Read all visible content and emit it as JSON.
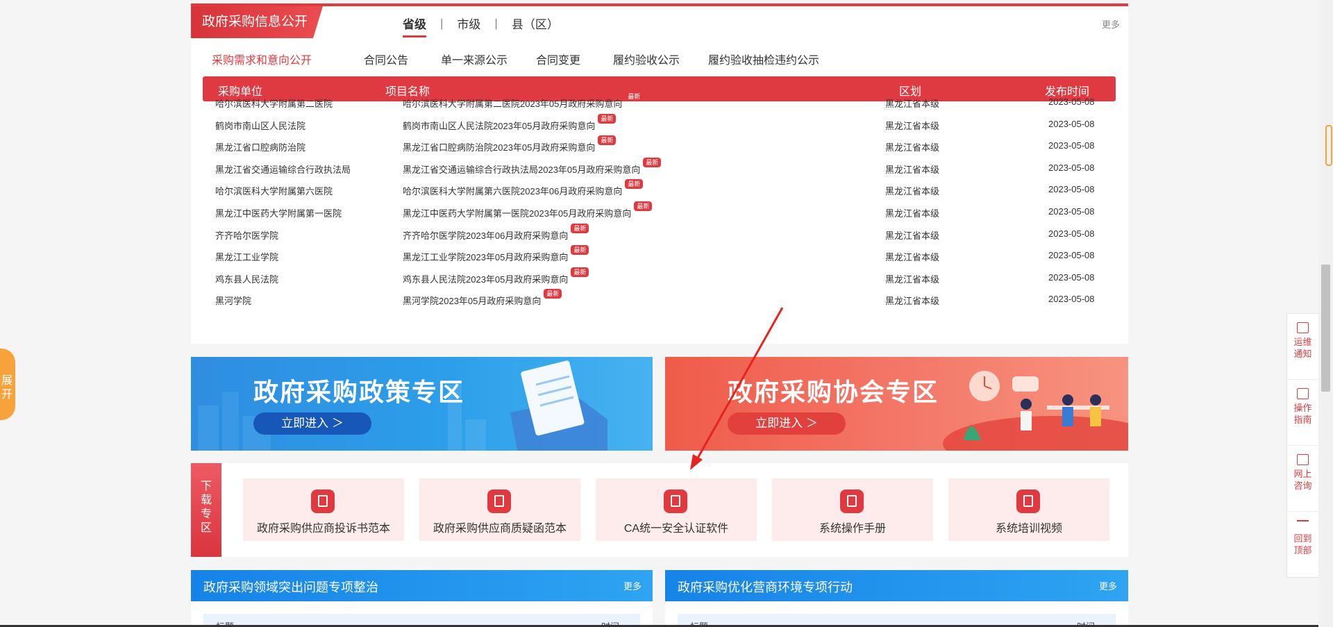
{
  "panel": {
    "title": "政府采购信息公开",
    "levels": [
      "省级",
      "市级",
      "县（区）"
    ],
    "separator": "|",
    "more": "更多",
    "categories": [
      "采购需求和意向公开",
      "合同公告",
      "单一来源公示",
      "合同变更",
      "履约验收公示",
      "履约验收抽检违约公示"
    ],
    "headers": [
      "采购单位",
      "项目名称",
      "区划",
      "发布时间"
    ],
    "badge": "最新",
    "rows": [
      {
        "unit": "哈尔滨医科大学附属第二医院",
        "name": "哈尔滨医科大学附属第二医院2023年05月政府采购意向",
        "region": "黑龙江省本级",
        "date": "2023-05-08"
      },
      {
        "unit": "鹤岗市南山区人民法院",
        "name": "鹤岗市南山区人民法院2023年05月政府采购意向",
        "region": "黑龙江省本级",
        "date": "2023-05-08"
      },
      {
        "unit": "黑龙江省口腔病防治院",
        "name": "黑龙江省口腔病防治院2023年05月政府采购意向",
        "region": "黑龙江省本级",
        "date": "2023-05-08"
      },
      {
        "unit": "黑龙江省交通运输综合行政执法局",
        "name": "黑龙江省交通运输综合行政执法局2023年05月政府采购意向",
        "region": "黑龙江省本级",
        "date": "2023-05-08"
      },
      {
        "unit": "哈尔滨医科大学附属第六医院",
        "name": "哈尔滨医科大学附属第六医院2023年06月政府采购意向",
        "region": "黑龙江省本级",
        "date": "2023-05-08"
      },
      {
        "unit": "黑龙江中医药大学附属第一医院",
        "name": "黑龙江中医药大学附属第一医院2023年05月政府采购意向",
        "region": "黑龙江省本级",
        "date": "2023-05-08"
      },
      {
        "unit": "齐齐哈尔医学院",
        "name": "齐齐哈尔医学院2023年06月政府采购意向",
        "region": "黑龙江省本级",
        "date": "2023-05-08"
      },
      {
        "unit": "黑龙江工业学院",
        "name": "黑龙江工业学院2023年05月政府采购意向",
        "region": "黑龙江省本级",
        "date": "2023-05-08"
      },
      {
        "unit": "鸡东县人民法院",
        "name": "鸡东县人民法院2023年05月政府采购意向",
        "region": "黑龙江省本级",
        "date": "2023-05-08"
      },
      {
        "unit": "黑河学院",
        "name": "黑河学院2023年05月政府采购意向",
        "region": "黑龙江省本级",
        "date": "2023-05-08"
      }
    ]
  },
  "banners": {
    "policy": {
      "title": "政府采购政策专区",
      "button": "立即进入 ＞"
    },
    "association": {
      "title": "政府采购协会专区",
      "button": "立即进入 ＞"
    }
  },
  "downloads": {
    "tag": [
      "下",
      "载",
      "专",
      "区"
    ],
    "items": [
      "政府采购供应商投诉书范本",
      "政府采购供应商质疑函范本",
      "CA统一安全认证软件",
      "系统操作手册",
      "系统培训视频"
    ]
  },
  "news": {
    "left": {
      "title": "政府采购领域突出问题专项整治",
      "more": "更多",
      "col_title": "标题",
      "col_time": "时间"
    },
    "right": {
      "title": "政府采购优化营商环境专项行动",
      "more": "更多",
      "col_title": "标题",
      "col_time": "时间"
    }
  },
  "side": {
    "expand": [
      "展",
      "开"
    ],
    "float_items": [
      {
        "label": "运维通知",
        "icon": "notice-icon"
      },
      {
        "label": "操作指南",
        "icon": "bookmark-icon"
      },
      {
        "label": "网上咨询",
        "icon": "chat-icon"
      },
      {
        "label": "回到顶部",
        "icon": "arrow-up-icon"
      }
    ]
  },
  "colors": {
    "brand_red": "#e03a3f",
    "blue": "#1683e8",
    "orange": "#f7a23a"
  }
}
